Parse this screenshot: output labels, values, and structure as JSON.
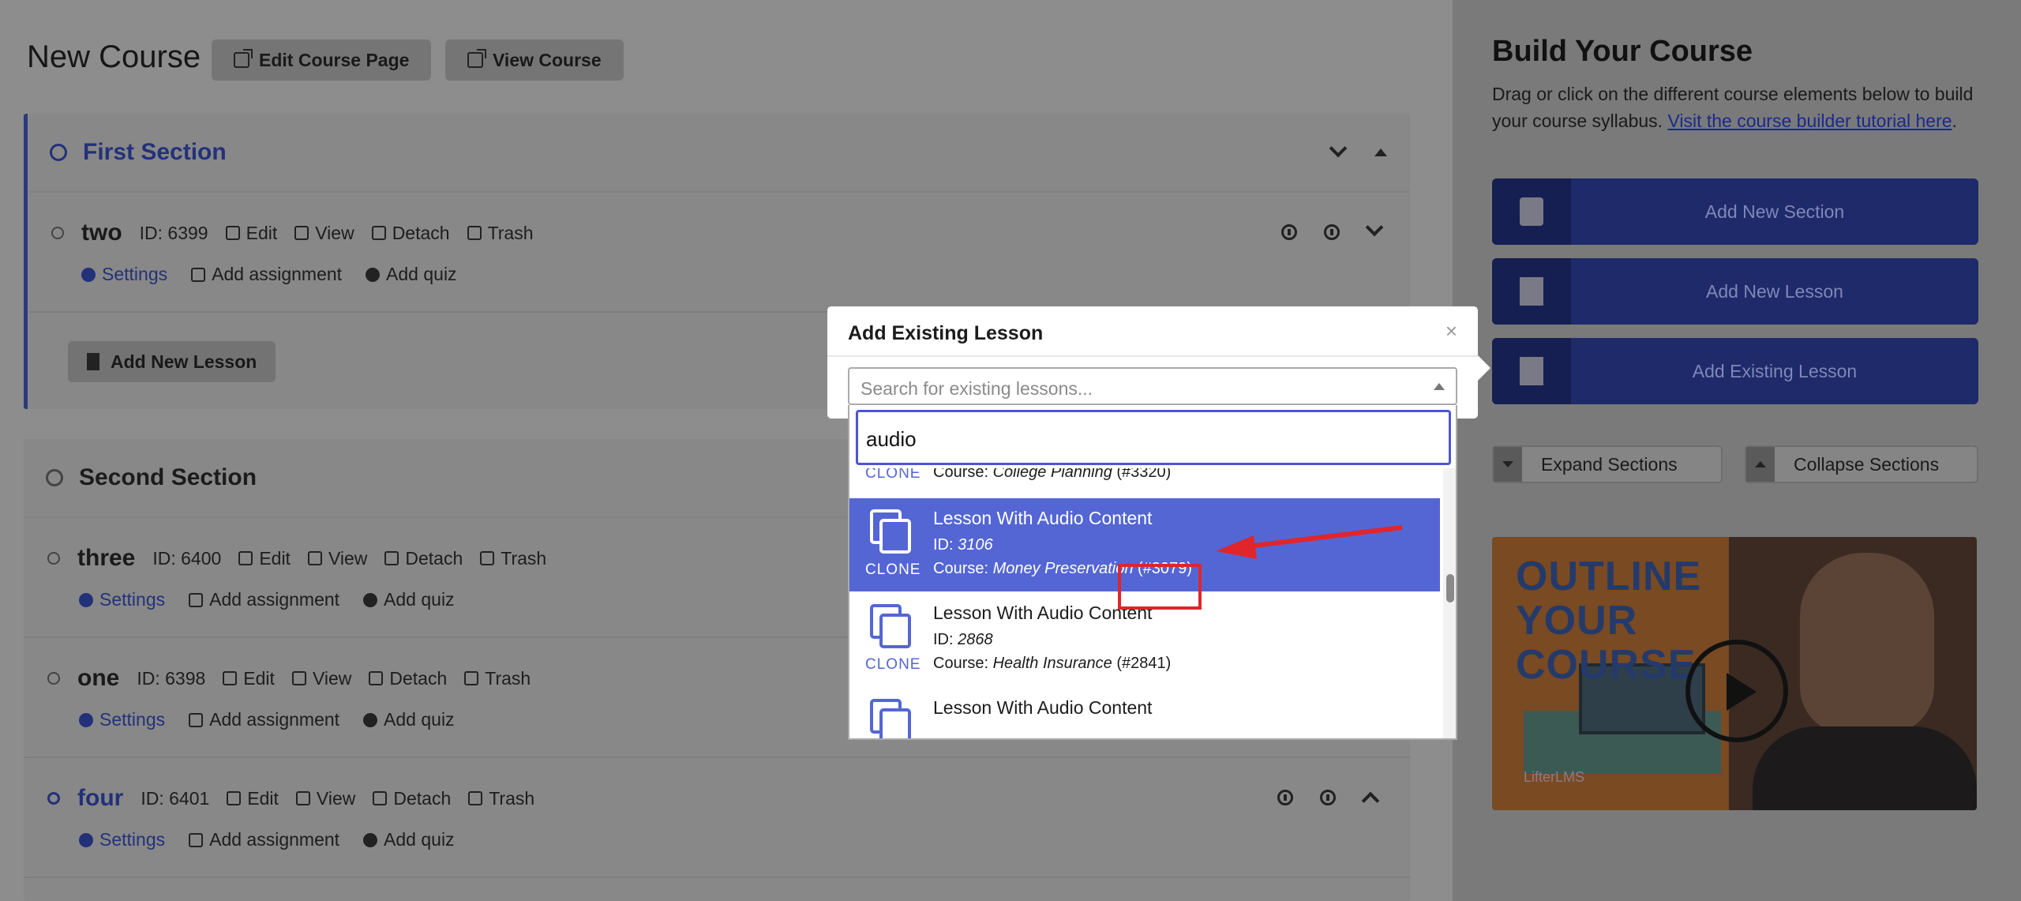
{
  "header": {
    "course_title": "New Course",
    "edit_course_page": "Edit Course Page",
    "view_course": "View Course"
  },
  "sections": [
    {
      "title": "First Section",
      "lessons": [
        {
          "name": "two",
          "id_text": "ID: 6399"
        }
      ],
      "add_new_lesson": "Add New Lesson"
    },
    {
      "title": "Second Section",
      "lessons": [
        {
          "name": "three",
          "id_text": "ID: 6400"
        },
        {
          "name": "one",
          "id_text": "ID: 6398"
        },
        {
          "name": "four",
          "id_text": "ID: 6401"
        }
      ]
    }
  ],
  "lesson_actions": {
    "edit": "Edit",
    "view": "View",
    "detach": "Detach",
    "trash": "Trash",
    "settings": "Settings",
    "add_assignment": "Add assignment",
    "add_quiz": "Add quiz"
  },
  "builder": {
    "title": "Build Your Course",
    "description": "Drag or click on the different course elements below to build your course syllabus. ",
    "tutorial_link": "Visit the course builder tutorial here",
    "description_end": ".",
    "add_new_section": "Add New Section",
    "add_new_lesson": "Add New Lesson",
    "add_existing_lesson": "Add Existing Lesson",
    "expand_sections": "Expand Sections",
    "collapse_sections": "Collapse Sections"
  },
  "video": {
    "line1": "OUTLINE",
    "line2": "YOUR",
    "line3": "COURSE",
    "brand": "LifterLMS"
  },
  "modal": {
    "title": "Add Existing Lesson",
    "close": "×",
    "select_placeholder": "Search for existing lessons...",
    "search_value": "audio",
    "clone_label": "CLONE",
    "results": [
      {
        "title": "",
        "id_label": "",
        "id_value": "",
        "course_label": "Course: ",
        "course_name": "College Planning",
        "course_id": " (#3320)"
      },
      {
        "title": "Lesson With Audio Content",
        "id_label": "ID: ",
        "id_value": "3106",
        "course_label": "Course: ",
        "course_name": "Money Preservation",
        "course_id": " (#3079)"
      },
      {
        "title": "Lesson With Audio Content",
        "id_label": "ID: ",
        "id_value": "2868",
        "course_label": "Course: ",
        "course_name": "Health Insurance",
        "course_id": " (#2841)"
      },
      {
        "title": "Lesson With Audio Content",
        "id_label": "",
        "id_value": "",
        "course_label": "",
        "course_name": "",
        "course_id": ""
      }
    ]
  },
  "colors": {
    "accent": "#5466d4",
    "builder_button": "#1e2a6a",
    "annotation_red": "#e0252b"
  }
}
